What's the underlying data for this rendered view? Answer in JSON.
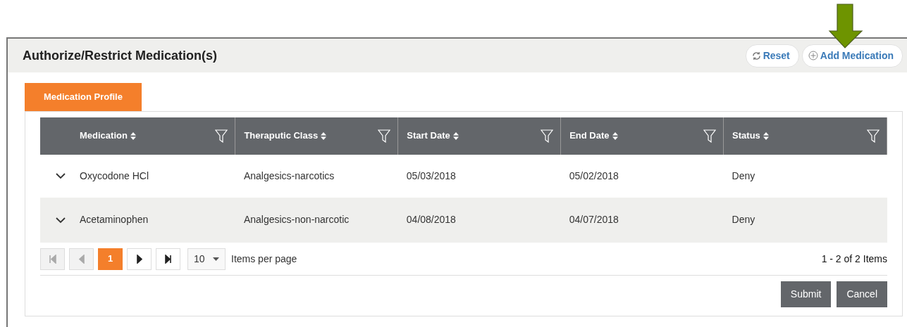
{
  "panel": {
    "title": "Authorize/Restrict Medication(s)",
    "actions": [
      {
        "kind": "reset",
        "label": "Reset"
      },
      {
        "kind": "add",
        "label": "Add Medication"
      }
    ]
  },
  "tabs": [
    {
      "label": "Medication Profile",
      "selected": true
    }
  ],
  "table": {
    "columns": [
      "Medication",
      "Theraputic Class",
      "Start Date",
      "End Date",
      "Status"
    ],
    "rows": [
      {
        "expanded": false,
        "cells": [
          "Oxycodone HCl",
          "Analgesics-narcotics",
          "05/03/2018",
          "05/02/2018",
          "Deny"
        ]
      },
      {
        "expanded": false,
        "cells": [
          "Acetaminophen",
          "Analgesics-non-narcotic",
          "04/08/2018",
          "04/07/2018",
          "Deny"
        ]
      }
    ]
  },
  "pager": {
    "buttons": [
      {
        "kind": "first",
        "disabled": true
      },
      {
        "kind": "prev",
        "disabled": true
      },
      {
        "kind": "page",
        "label": "1",
        "selected": true
      },
      {
        "kind": "next",
        "disabled": false
      },
      {
        "kind": "last",
        "disabled": false
      }
    ],
    "page_size": "10",
    "page_size_label": "Items per page",
    "summary": "1 - 2 of 2 Items"
  },
  "footer_buttons": [
    "Submit",
    "Cancel"
  ]
}
